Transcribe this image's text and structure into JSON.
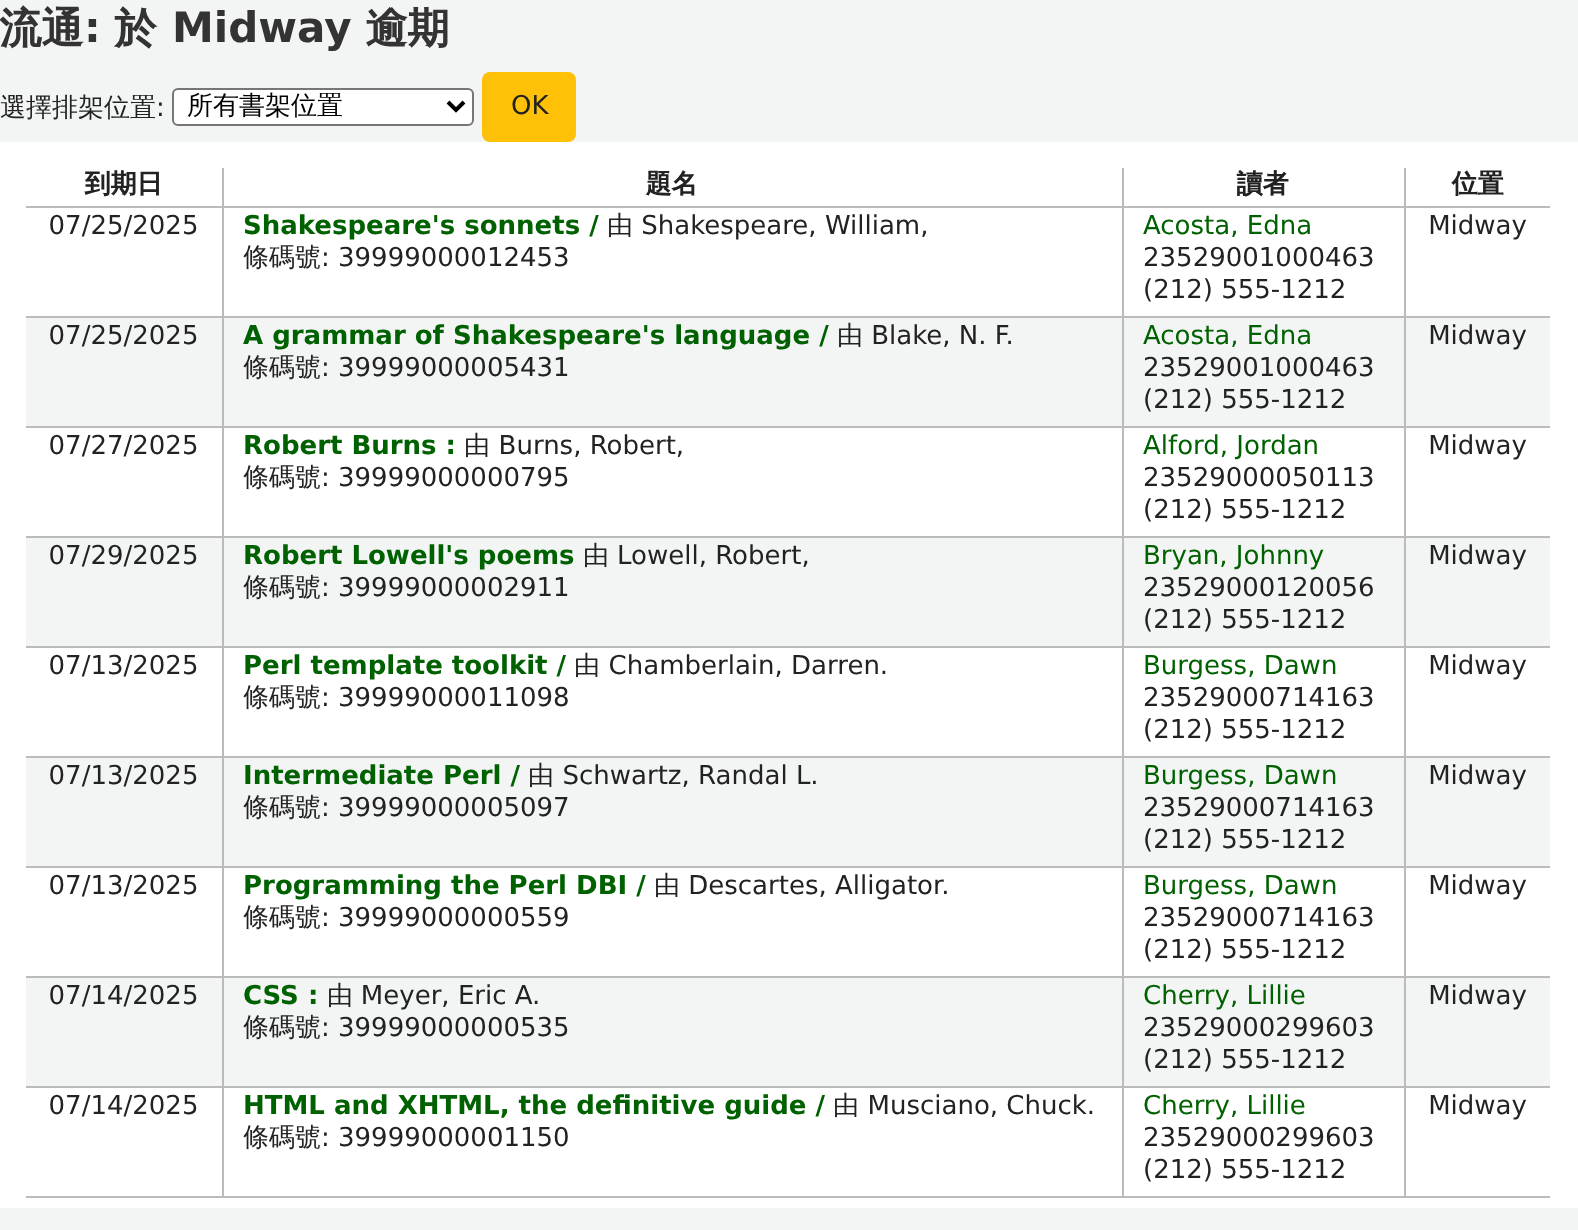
{
  "heading": "流通: 於 Midway 逾期",
  "filter": {
    "label": "選擇排架位置:",
    "value": "所有書架位置",
    "button": "OK"
  },
  "table": {
    "columns": [
      "到期日",
      "題名",
      "讀者",
      "位置"
    ],
    "rows": [
      {
        "due": "07/25/2025",
        "title": "Shakespeare's sonnets /",
        "author": "由 Shakespeare, William,",
        "barcode": "條碼號: 39999000012453",
        "patron": "Acosta, Edna",
        "cardnumber": "23529001000463",
        "phone": "(212) 555-1212",
        "location": "Midway"
      },
      {
        "due": "07/25/2025",
        "title": "A grammar of Shakespeare's language /",
        "author": "由 Blake, N. F.",
        "barcode": "條碼號: 39999000005431",
        "patron": "Acosta, Edna",
        "cardnumber": "23529001000463",
        "phone": "(212) 555-1212",
        "location": "Midway"
      },
      {
        "due": "07/27/2025",
        "title": "Robert Burns :",
        "author": "由 Burns, Robert,",
        "barcode": "條碼號: 39999000000795",
        "patron": "Alford, Jordan",
        "cardnumber": "23529000050113",
        "phone": "(212) 555-1212",
        "location": "Midway"
      },
      {
        "due": "07/29/2025",
        "title": "Robert Lowell's poems",
        "author": "由 Lowell, Robert,",
        "barcode": "條碼號: 39999000002911",
        "patron": "Bryan, Johnny",
        "cardnumber": "23529000120056",
        "phone": "(212) 555-1212",
        "location": "Midway"
      },
      {
        "due": "07/13/2025",
        "title": "Perl template toolkit /",
        "author": "由 Chamberlain, Darren.",
        "barcode": "條碼號: 39999000011098",
        "patron": "Burgess, Dawn",
        "cardnumber": "23529000714163",
        "phone": "(212) 555-1212",
        "location": "Midway"
      },
      {
        "due": "07/13/2025",
        "title": "Intermediate Perl /",
        "author": "由 Schwartz, Randal L.",
        "barcode": "條碼號: 39999000005097",
        "patron": "Burgess, Dawn",
        "cardnumber": "23529000714163",
        "phone": "(212) 555-1212",
        "location": "Midway"
      },
      {
        "due": "07/13/2025",
        "title": "Programming the Perl DBI /",
        "author": "由 Descartes, Alligator.",
        "barcode": "條碼號: 39999000000559",
        "patron": "Burgess, Dawn",
        "cardnumber": "23529000714163",
        "phone": "(212) 555-1212",
        "location": "Midway"
      },
      {
        "due": "07/14/2025",
        "title": "CSS :",
        "author": "由 Meyer, Eric A.",
        "barcode": "條碼號: 39999000000535",
        "patron": "Cherry, Lillie",
        "cardnumber": "23529000299603",
        "phone": "(212) 555-1212",
        "location": "Midway"
      },
      {
        "due": "07/14/2025",
        "title": "HTML and XHTML, the definitive guide /",
        "author": "由 Musciano, Chuck.",
        "barcode": "條碼號: 39999000001150",
        "patron": "Cherry, Lillie",
        "cardnumber": "23529000299603",
        "phone": "(212) 555-1212",
        "location": "Midway"
      }
    ]
  }
}
